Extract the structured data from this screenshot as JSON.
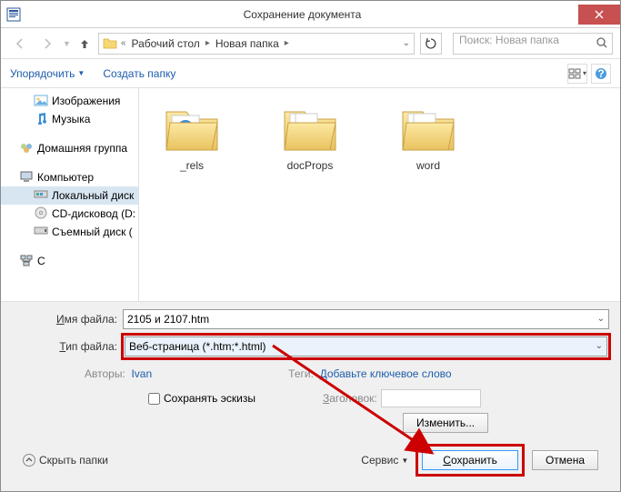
{
  "title": "Сохранение документа",
  "breadcrumb": {
    "prefix": "«",
    "items": [
      "Рабочий стол",
      "Новая папка"
    ]
  },
  "search_placeholder": "Поиск: Новая папка",
  "toolbar": {
    "organize": "Упорядочить",
    "new_folder": "Создать папку"
  },
  "tree": {
    "images": "Изображения",
    "music": "Музыка",
    "homegroup": "Домашняя группа",
    "computer": "Компьютер",
    "localdisk": "Локальный диск",
    "cddrive": "CD-дисковод (D:",
    "removable": "Съемный диск (",
    "network": "С"
  },
  "folders": [
    {
      "name": "_rels"
    },
    {
      "name": "docProps"
    },
    {
      "name": "word"
    }
  ],
  "labels": {
    "filename": "Имя файла:",
    "filetype": "Тип файла:",
    "authors": "Авторы:",
    "tags": "Теги:",
    "add_tags": "Добавьте ключевое слово",
    "save_thumbs": "Сохранять эскизы",
    "heading": "Заголовок:",
    "change": "Изменить...",
    "hide_folders": "Скрыть папки",
    "service": "Сервис",
    "save": "Сохранить",
    "cancel": "Отмена"
  },
  "values": {
    "filename": "2105 и 2107.htm",
    "filetype": "Веб-страница (*.htm;*.html)",
    "author": "Ivan"
  }
}
